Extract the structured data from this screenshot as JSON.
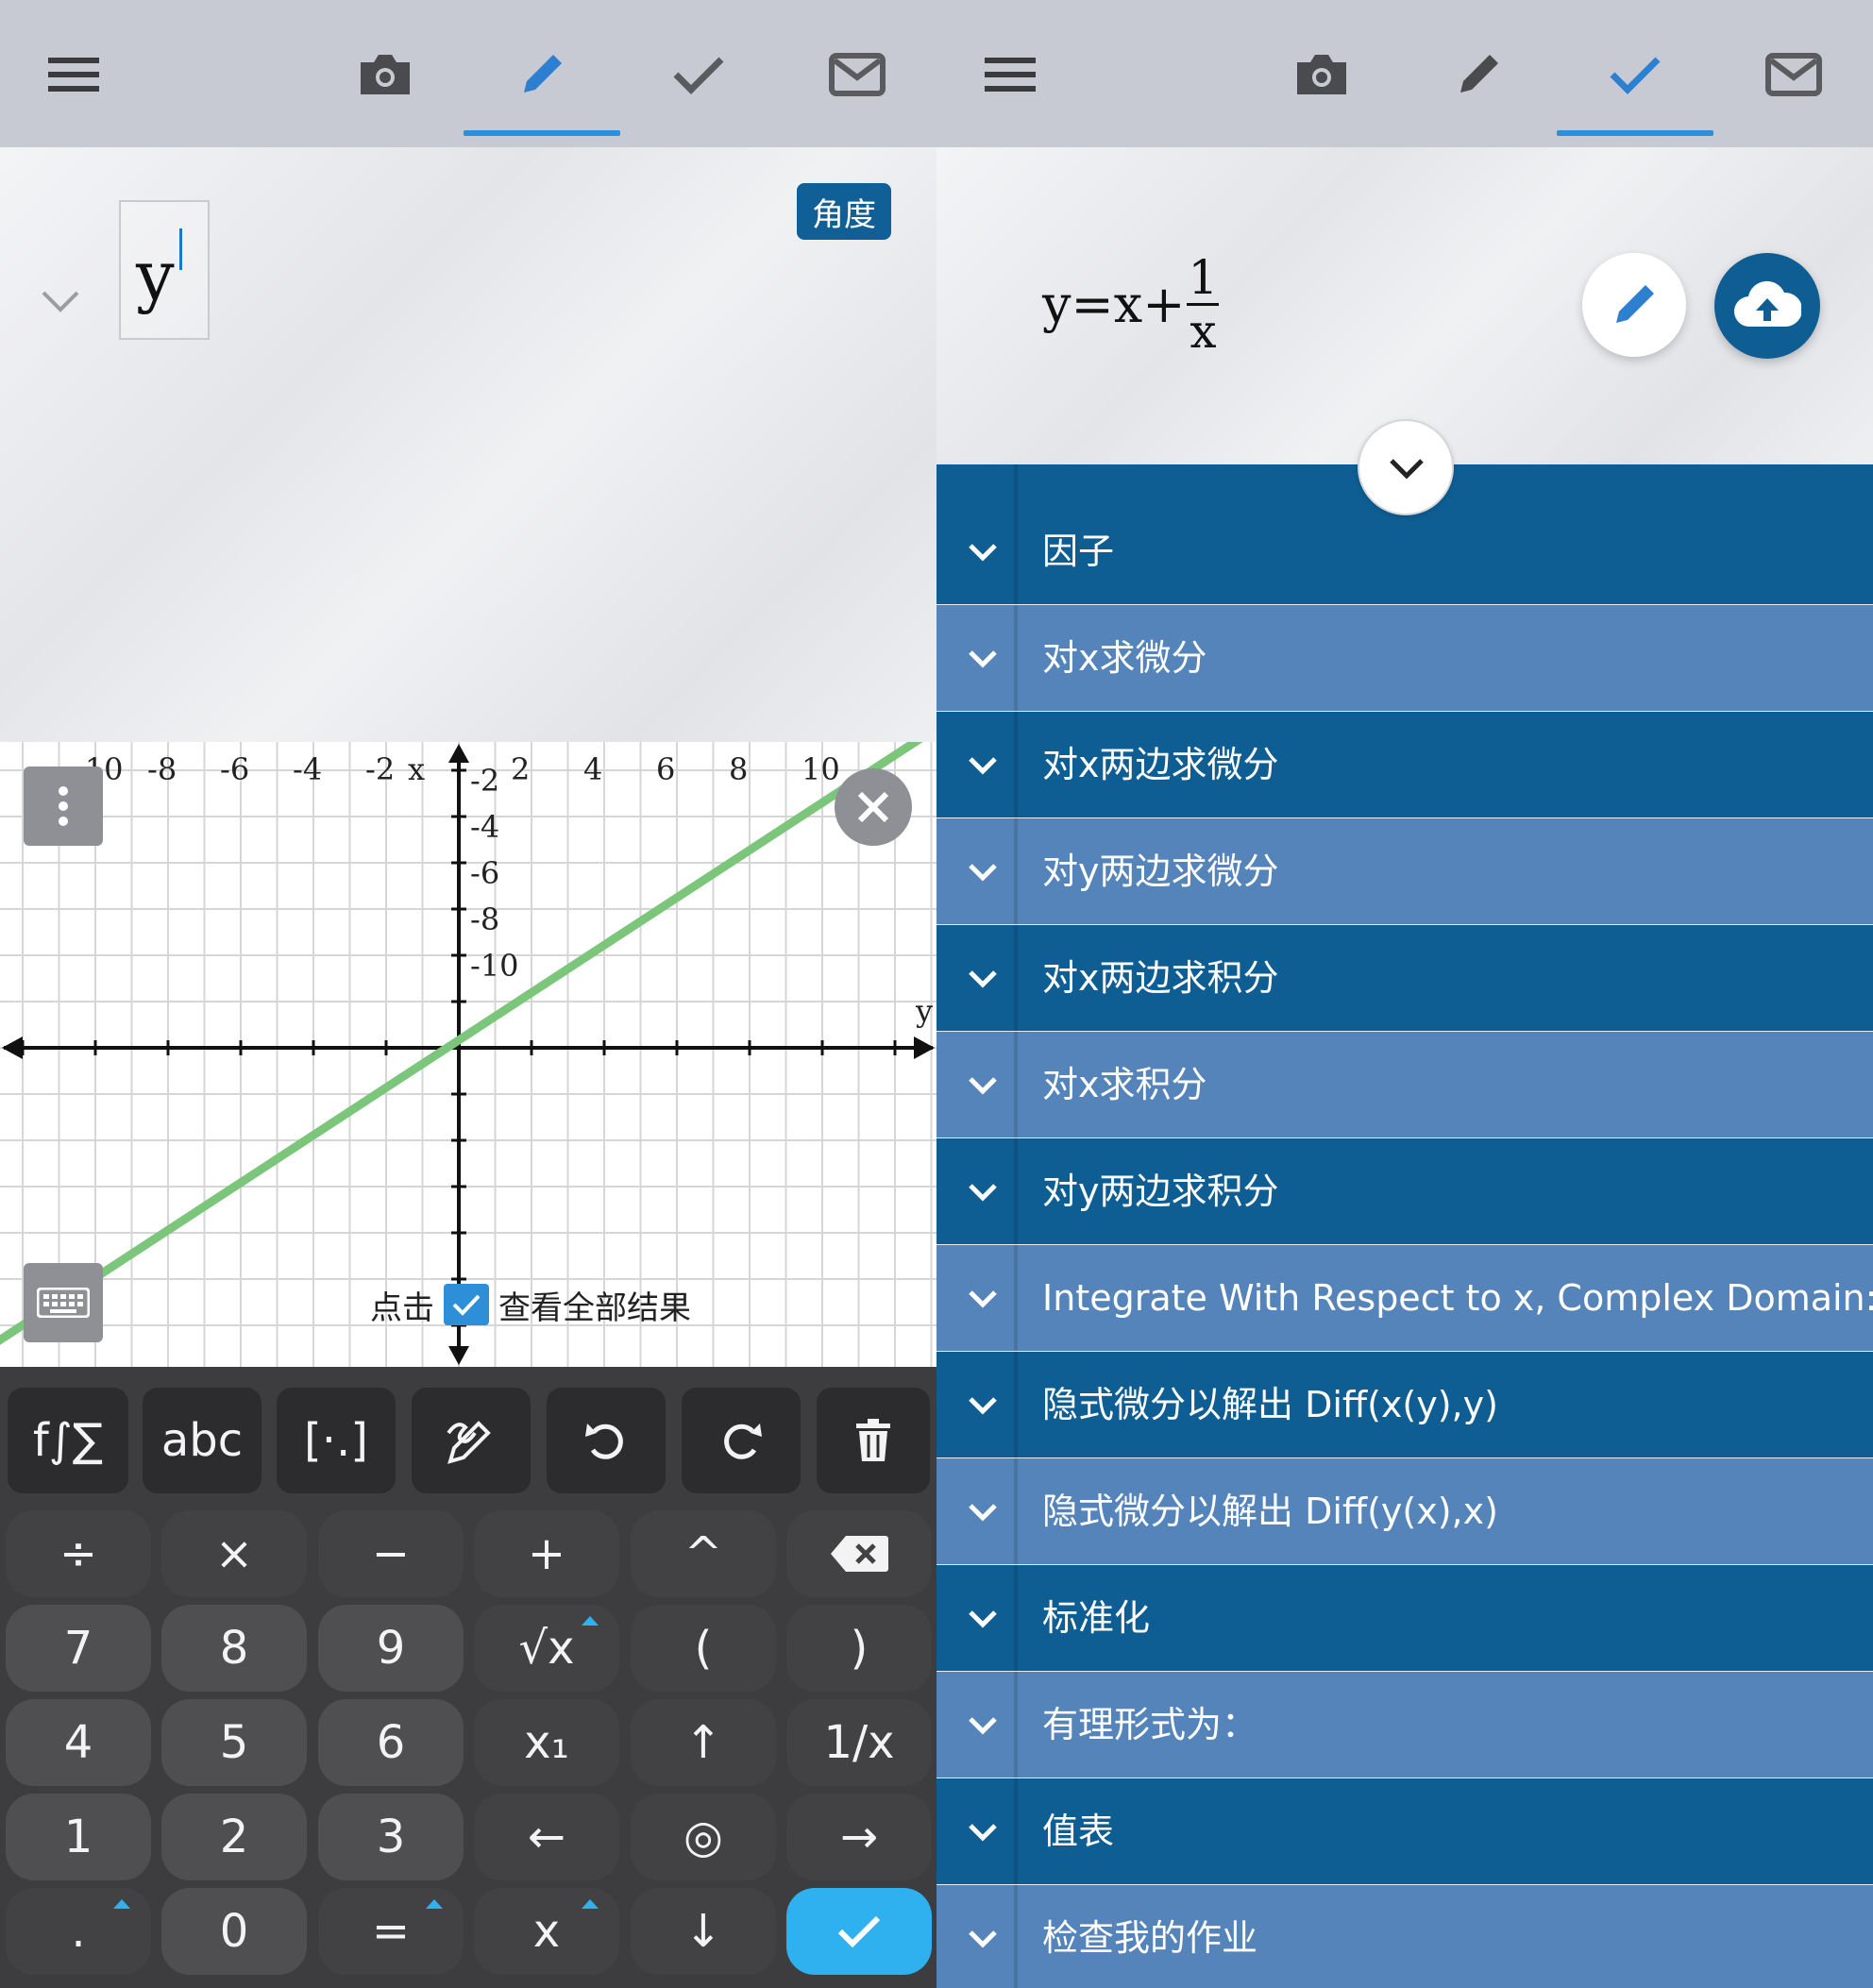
{
  "left": {
    "topbar": {
      "icons": [
        "menu-icon",
        "camera-icon",
        "pencil-icon",
        "check-icon",
        "mail-icon"
      ],
      "active": "pencil-icon"
    },
    "editor": {
      "input_text": "y",
      "mode_button": "角度"
    },
    "graph": {
      "x_ticks": [
        "-10",
        "-8",
        "-6",
        "-4",
        "-2",
        "2",
        "4",
        "6",
        "8",
        "10"
      ],
      "y_ticks": [
        "-2",
        "-4",
        "-6",
        "-8",
        "-10"
      ],
      "x_axis_label": "x",
      "y_axis_label": "y",
      "hint_prefix": "点击",
      "hint_suffix": "查看全部结果",
      "line_color": "#7bc67a"
    },
    "keyboard": {
      "row0": [
        "f∫∑",
        "abc",
        "[·.]",
        "handwrite-icon",
        "undo-icon",
        "redo-icon",
        "trash-icon"
      ],
      "row1": [
        "÷",
        "×",
        "−",
        "+",
        "^",
        "backspace-icon"
      ],
      "row2": [
        "7",
        "8",
        "9",
        "√x",
        "(",
        ")"
      ],
      "row3": [
        "4",
        "5",
        "6",
        "x₁",
        "↑",
        "1/x"
      ],
      "row4": [
        "1",
        "2",
        "3",
        "←",
        "◎",
        "→"
      ],
      "row5": [
        ".",
        "0",
        "=",
        "x",
        "↓",
        "check-icon"
      ]
    }
  },
  "right": {
    "topbar": {
      "icons": [
        "menu-icon",
        "camera-icon",
        "pencil-icon",
        "check-icon",
        "mail-icon"
      ],
      "active": "check-icon"
    },
    "formula": {
      "lhs": "y=x+",
      "numerator": "1",
      "denominator": "x"
    },
    "results": [
      {
        "label": "因子",
        "tone": "dark"
      },
      {
        "label": "对x求微分",
        "tone": "light"
      },
      {
        "label": "对x两边求微分",
        "tone": "dark"
      },
      {
        "label": "对y两边求微分",
        "tone": "light"
      },
      {
        "label": "对x两边求积分",
        "tone": "dark"
      },
      {
        "label": "对x求积分",
        "tone": "light"
      },
      {
        "label": "对y两边求积分",
        "tone": "dark"
      },
      {
        "label": "Integrate With Respect to x, Complex Domain:",
        "tone": "light"
      },
      {
        "label": "隐式微分以解出 Diff(x(y),y)",
        "tone": "dark"
      },
      {
        "label": "隐式微分以解出 Diff(y(x),x)",
        "tone": "light"
      },
      {
        "label": "标准化",
        "tone": "dark"
      },
      {
        "label": "有理形式为：",
        "tone": "light"
      },
      {
        "label": "值表",
        "tone": "dark"
      },
      {
        "label": "检查我的作业",
        "tone": "light"
      }
    ]
  },
  "colors": {
    "accent": "#2d8fd7",
    "dark_row": "#0e5e94",
    "light_row": "#5484b9",
    "confirm": "#2fb0ef"
  }
}
